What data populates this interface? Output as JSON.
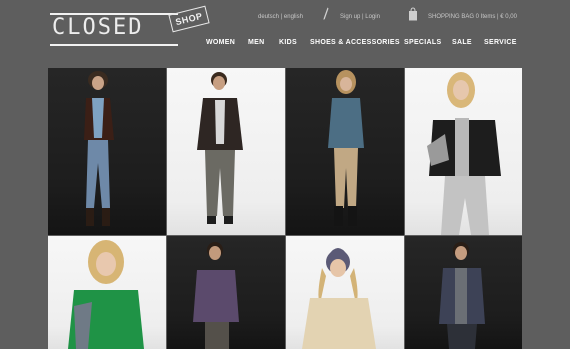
{
  "brand": {
    "logo_text": "CLOSED",
    "badge_text": "SHOP"
  },
  "utility": {
    "lang_text": "deutsch | english",
    "signup_text": "Sign up | Login",
    "bag_text": "SHOPPING BAG 0 Items | € 0,00"
  },
  "nav": {
    "items": [
      "WOMEN",
      "MEN",
      "KIDS",
      "SHOES & ACCESSORIES",
      "SPECIALS",
      "SALE",
      "SERVICE"
    ]
  },
  "icons": {
    "utility": [
      "pen-icon",
      "shopping-bag-icon"
    ]
  },
  "colors": {
    "background": "#5e5e5e",
    "nav_text": "#ffffff",
    "utility_text": "#c8c8c8"
  }
}
